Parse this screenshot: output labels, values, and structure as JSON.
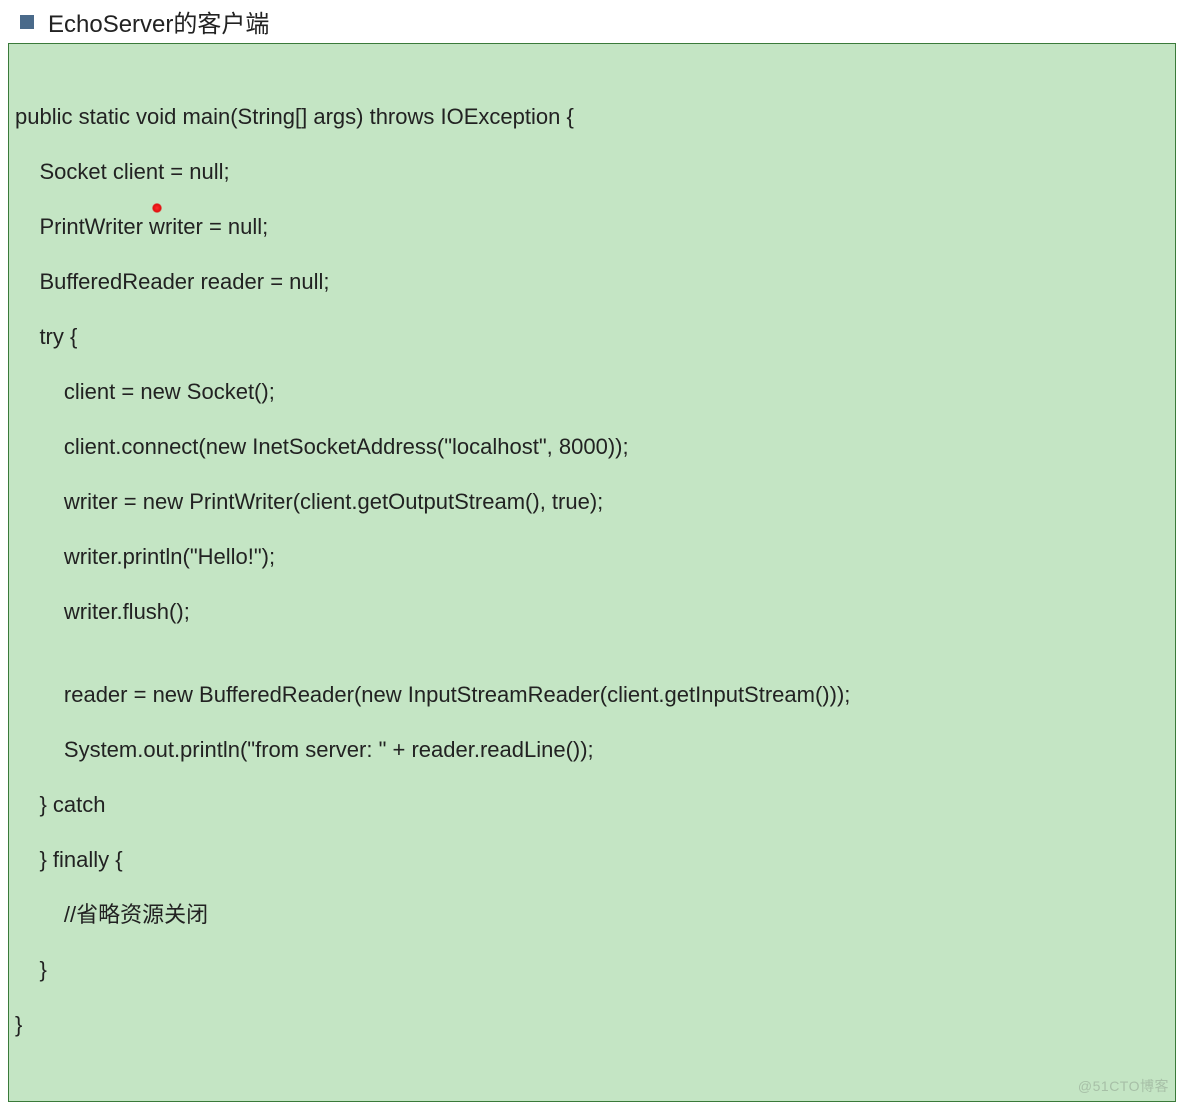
{
  "heading": "EchoServer的客户端",
  "watermark": "@51CTO博客",
  "code": {
    "l1": "public static void main(String[] args) throws IOException {",
    "l2": "    Socket client = null;",
    "l3": "    PrintWriter writer = null;",
    "l4": "    BufferedReader reader = null;",
    "l5": "    try {",
    "l6": "        client = new Socket();",
    "l7": "        client.connect(new InetSocketAddress(\"localhost\", 8000));",
    "l8": "        writer = new PrintWriter(client.getOutputStream(), true);",
    "l9": "        writer.println(\"Hello!\");",
    "l10": "        writer.flush();",
    "l11": "",
    "l12": "        reader = new BufferedReader(new InputStreamReader(client.getInputStream()));",
    "l13": "        System.out.println(\"from server: \" + reader.readLine());",
    "l14": "    } catch",
    "l15": "    } finally {",
    "l16": "        //省略资源关闭",
    "l17": "    }",
    "l18": "}"
  }
}
